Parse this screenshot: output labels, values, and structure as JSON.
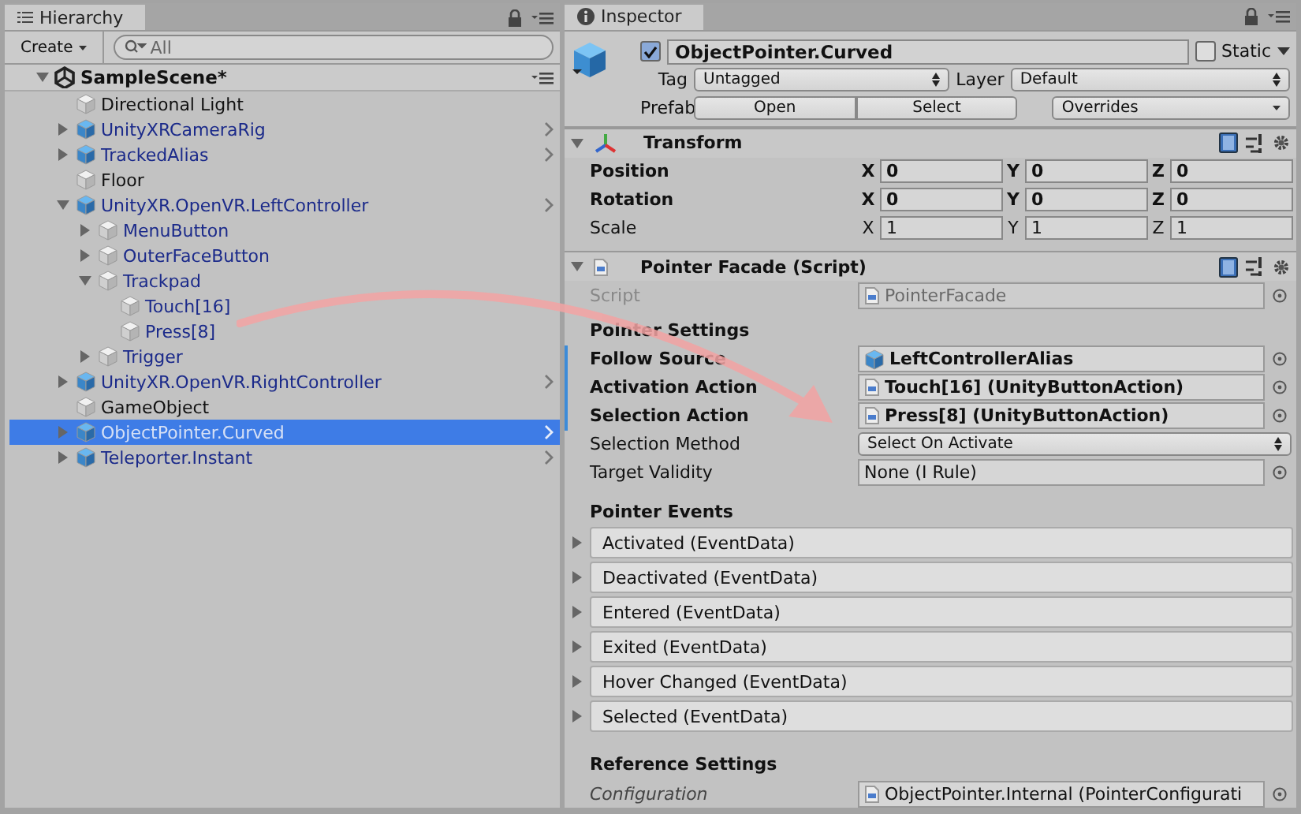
{
  "hierarchy": {
    "tab": "Hierarchy",
    "create_button": "Create",
    "search": {
      "placeholder": "All"
    },
    "scene": {
      "name": "SampleScene*",
      "expanded": true,
      "children": [
        {
          "name": "Directional Light",
          "kind": "object",
          "selected": false
        },
        {
          "name": "UnityXRCameraRig",
          "kind": "prefab",
          "expanded": false,
          "selected": false
        },
        {
          "name": "TrackedAlias",
          "kind": "prefab",
          "expanded": false,
          "selected": false
        },
        {
          "name": "Floor",
          "kind": "object",
          "selected": false
        },
        {
          "name": "UnityXR.OpenVR.LeftController",
          "kind": "prefab",
          "expanded": true,
          "selected": false,
          "children": [
            {
              "name": "MenuButton",
              "kind": "part",
              "expanded": false,
              "selected": false
            },
            {
              "name": "OuterFaceButton",
              "kind": "part",
              "expanded": false,
              "selected": false
            },
            {
              "name": "Trackpad",
              "kind": "part",
              "expanded": true,
              "selected": false,
              "children": [
                {
                  "name": "Touch[16]",
                  "kind": "part",
                  "selected": false
                },
                {
                  "name": "Press[8]",
                  "kind": "part",
                  "selected": false
                }
              ]
            },
            {
              "name": "Trigger",
              "kind": "part",
              "expanded": false,
              "selected": false
            }
          ]
        },
        {
          "name": "UnityXR.OpenVR.RightController",
          "kind": "prefab",
          "expanded": false,
          "selected": false
        },
        {
          "name": "GameObject",
          "kind": "object",
          "selected": false
        },
        {
          "name": "ObjectPointer.Curved",
          "kind": "prefab",
          "expanded": false,
          "selected": true
        },
        {
          "name": "Teleporter.Instant",
          "kind": "prefab",
          "expanded": false,
          "selected": false
        }
      ]
    }
  },
  "inspector": {
    "tab": "Inspector",
    "object": {
      "name": "ObjectPointer.Curved",
      "active": true,
      "static": false,
      "static_label": "Static",
      "tag_label": "Tag",
      "tag": "Untagged",
      "layer_label": "Layer",
      "layer": "Default",
      "prefab_label": "Prefab",
      "prefab_buttons": [
        "Open",
        "Select"
      ],
      "overrides": "Overrides"
    },
    "transform": {
      "title": "Transform",
      "expanded": true,
      "rows": [
        {
          "label": "Position",
          "overridden": true,
          "values": [
            {
              "axis": "X",
              "value": "0"
            },
            {
              "axis": "Y",
              "value": "0"
            },
            {
              "axis": "Z",
              "value": "0"
            }
          ]
        },
        {
          "label": "Rotation",
          "overridden": true,
          "values": [
            {
              "axis": "X",
              "value": "0"
            },
            {
              "axis": "Y",
              "value": "0"
            },
            {
              "axis": "Z",
              "value": "0"
            }
          ]
        },
        {
          "label": "Scale",
          "overridden": false,
          "values": [
            {
              "axis": "X",
              "value": "1"
            },
            {
              "axis": "Y",
              "value": "1"
            },
            {
              "axis": "Z",
              "value": "1"
            }
          ]
        }
      ]
    },
    "component": {
      "title": "Pointer Facade (Script)",
      "expanded": true,
      "script": {
        "label": "Script",
        "value": "PointerFacade",
        "disabled": true
      },
      "settings_header": "Pointer Settings",
      "properties": [
        {
          "label": "Follow Source",
          "kind": "object",
          "overridden": true,
          "value": "LeftControllerAlias"
        },
        {
          "label": "Activation Action",
          "kind": "script",
          "overridden": true,
          "value": "Touch[16] (UnityButtonAction)"
        },
        {
          "label": "Selection Action",
          "kind": "script",
          "overridden": true,
          "value": "Press[8] (UnityButtonAction)"
        },
        {
          "label": "Selection Method",
          "kind": "dropdown",
          "overridden": false,
          "value": "Select On Activate"
        },
        {
          "label": "Target Validity",
          "kind": "none",
          "overridden": false,
          "value": "None (I Rule)"
        }
      ],
      "events_header": "Pointer Events",
      "events": [
        {
          "label": "Activated (EventData)",
          "expanded": false
        },
        {
          "label": "Deactivated (EventData)",
          "expanded": false
        },
        {
          "label": "Entered (EventData)",
          "expanded": false
        },
        {
          "label": "Exited (EventData)",
          "expanded": false
        },
        {
          "label": "Hover Changed (EventData)",
          "expanded": false
        },
        {
          "label": "Selected (EventData)",
          "expanded": false
        }
      ],
      "reference_header": "Reference Settings",
      "configuration": {
        "label": "Configuration",
        "value": "ObjectPointer.Internal (PointerConfigurati"
      }
    }
  }
}
